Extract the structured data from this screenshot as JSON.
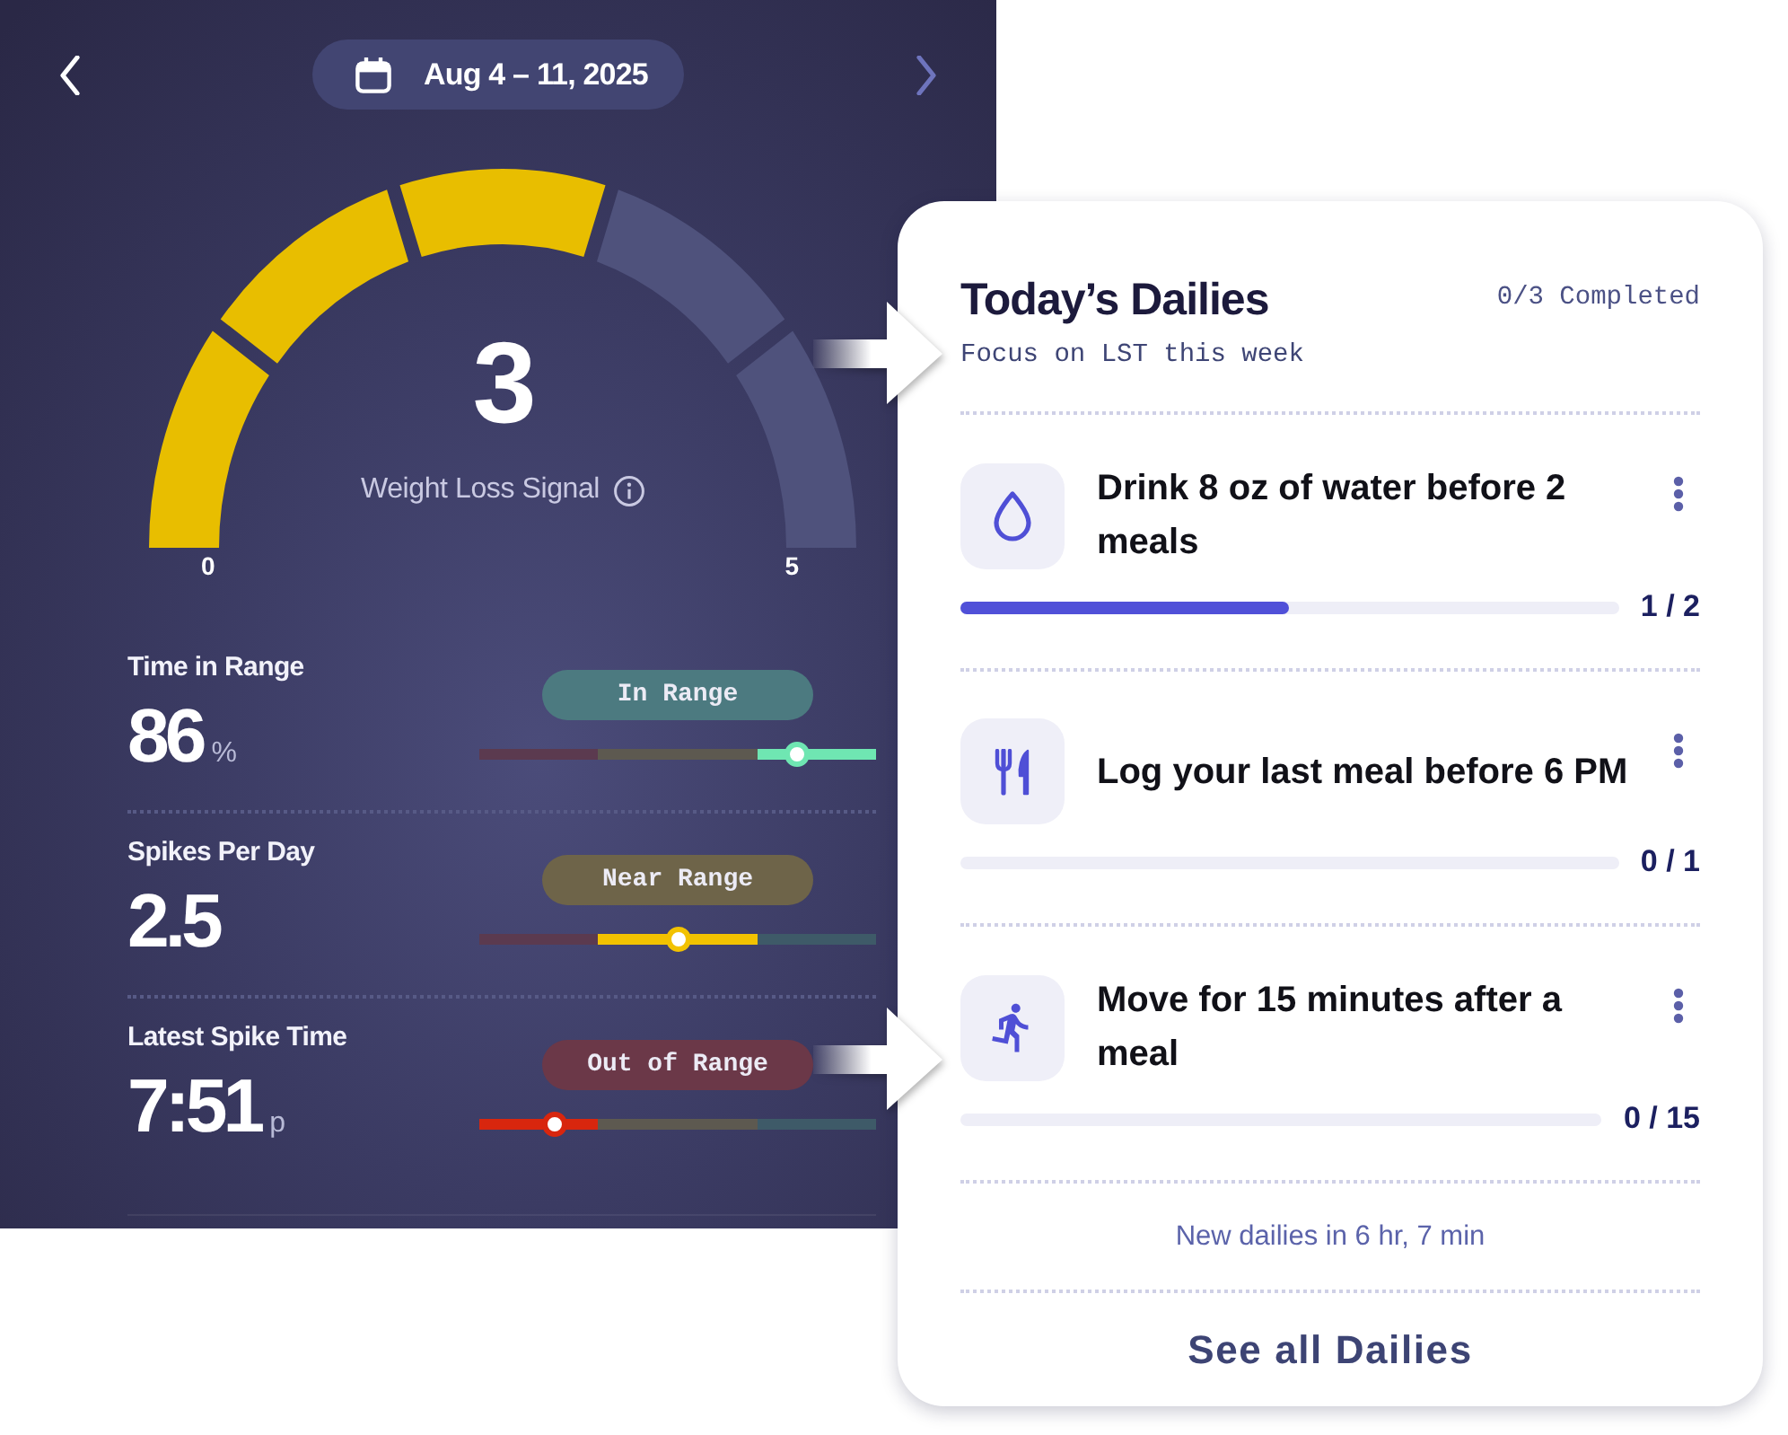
{
  "header": {
    "date_range": "Aug 4 – 11, 2025",
    "prev_disabled": false,
    "next_disabled": true
  },
  "gauge": {
    "value": "3",
    "label": "Weight Loss Signal",
    "min_label": "0",
    "max_label": "5",
    "level": 0.6
  },
  "metrics": [
    {
      "kind": "in",
      "label": "Time in Range",
      "value": "86",
      "unit": "%",
      "status": "In Range",
      "level": 0.8
    },
    {
      "kind": "near",
      "label": "Spikes Per Day",
      "value": "2.5",
      "status": "Near Range",
      "level": 0.5
    },
    {
      "kind": "out",
      "label": "Latest Spike Time",
      "value": "7:51",
      "unit": "p",
      "status": "Out of Range",
      "level": 0.19
    }
  ],
  "dailies": {
    "title": "Today’s Dailies",
    "completed": "0/3 Completed",
    "subtitle": "Focus on LST this week",
    "tasks": [
      {
        "kind": "water",
        "title": "Drink 8 oz of water before 2 meals",
        "level": 0.5,
        "count": "1 / 2"
      },
      {
        "kind": "meal",
        "title": "Log your last meal before 6 PM",
        "level": 0,
        "count": "0 / 1"
      },
      {
        "kind": "move",
        "title": "Move for 15 minutes after a meal",
        "level": 0,
        "count": "0 / 15"
      }
    ],
    "note": "New dailies in 6 hr, 7 min",
    "see_all": "See all Dailies"
  }
}
